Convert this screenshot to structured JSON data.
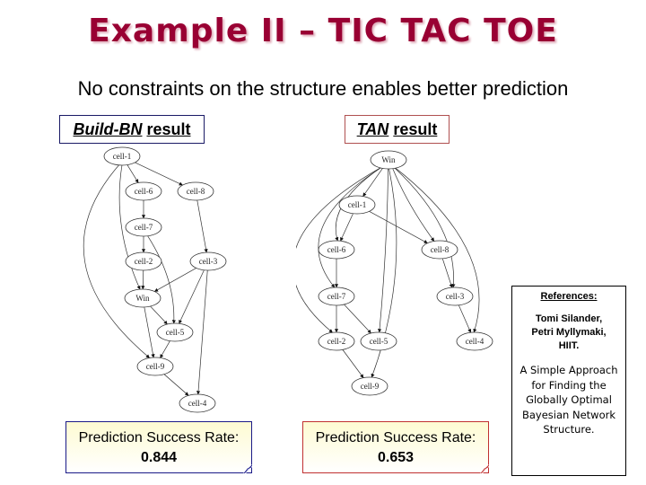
{
  "slide": {
    "title": "Example II – TIC TAC TOE",
    "subtitle": "No constraints on the structure enables better prediction"
  },
  "build_bn": {
    "label_italic": "Build-BN",
    "label_rest": "result",
    "rate_label": "Prediction Success Rate:",
    "rate_value": "0.844",
    "accent": "#1a1a88",
    "nodes": [
      "cell-1",
      "cell-6",
      "cell-8",
      "cell-7",
      "cell-2",
      "cell-3",
      "Win",
      "cell-5",
      "cell-9",
      "cell-4"
    ],
    "edges": [
      [
        "cell-1",
        "cell-6"
      ],
      [
        "cell-1",
        "cell-8"
      ],
      [
        "cell-1",
        "Win"
      ],
      [
        "cell-1",
        "cell-9"
      ],
      [
        "cell-6",
        "cell-7"
      ],
      [
        "cell-7",
        "cell-2"
      ],
      [
        "cell-7",
        "cell-5"
      ],
      [
        "cell-8",
        "cell-3"
      ],
      [
        "cell-2",
        "Win"
      ],
      [
        "cell-3",
        "Win"
      ],
      [
        "cell-3",
        "cell-5"
      ],
      [
        "cell-3",
        "cell-4"
      ],
      [
        "Win",
        "cell-5"
      ],
      [
        "Win",
        "cell-9"
      ],
      [
        "cell-5",
        "cell-9"
      ],
      [
        "cell-9",
        "cell-4"
      ]
    ]
  },
  "tan": {
    "label_italic": "TAN",
    "label_rest": "result",
    "rate_label": "Prediction Success Rate:",
    "rate_value": "0.653",
    "accent": "#c03030",
    "nodes": [
      "Win",
      "cell-1",
      "cell-6",
      "cell-8",
      "cell-7",
      "cell-3",
      "cell-2",
      "cell-5",
      "cell-4",
      "cell-9"
    ],
    "edges": [
      [
        "Win",
        "cell-1"
      ],
      [
        "Win",
        "cell-6"
      ],
      [
        "Win",
        "cell-7"
      ],
      [
        "Win",
        "cell-2"
      ],
      [
        "Win",
        "cell-5"
      ],
      [
        "Win",
        "cell-9"
      ],
      [
        "Win",
        "cell-8"
      ],
      [
        "Win",
        "cell-3"
      ],
      [
        "Win",
        "cell-4"
      ],
      [
        "cell-1",
        "cell-6"
      ],
      [
        "cell-1",
        "cell-8"
      ],
      [
        "cell-6",
        "cell-7"
      ],
      [
        "cell-7",
        "cell-2"
      ],
      [
        "cell-7",
        "cell-5"
      ],
      [
        "cell-8",
        "cell-3"
      ],
      [
        "cell-3",
        "cell-4"
      ],
      [
        "cell-2",
        "cell-9"
      ]
    ]
  },
  "references": {
    "heading": "References:",
    "authors": [
      "Tomi Silander,",
      "Petri Myllymaki,",
      "HIIT."
    ],
    "paper": [
      "A Simple Approach",
      "for Finding the",
      "Globally Optimal",
      "Bayesian Network",
      "Structure."
    ]
  }
}
